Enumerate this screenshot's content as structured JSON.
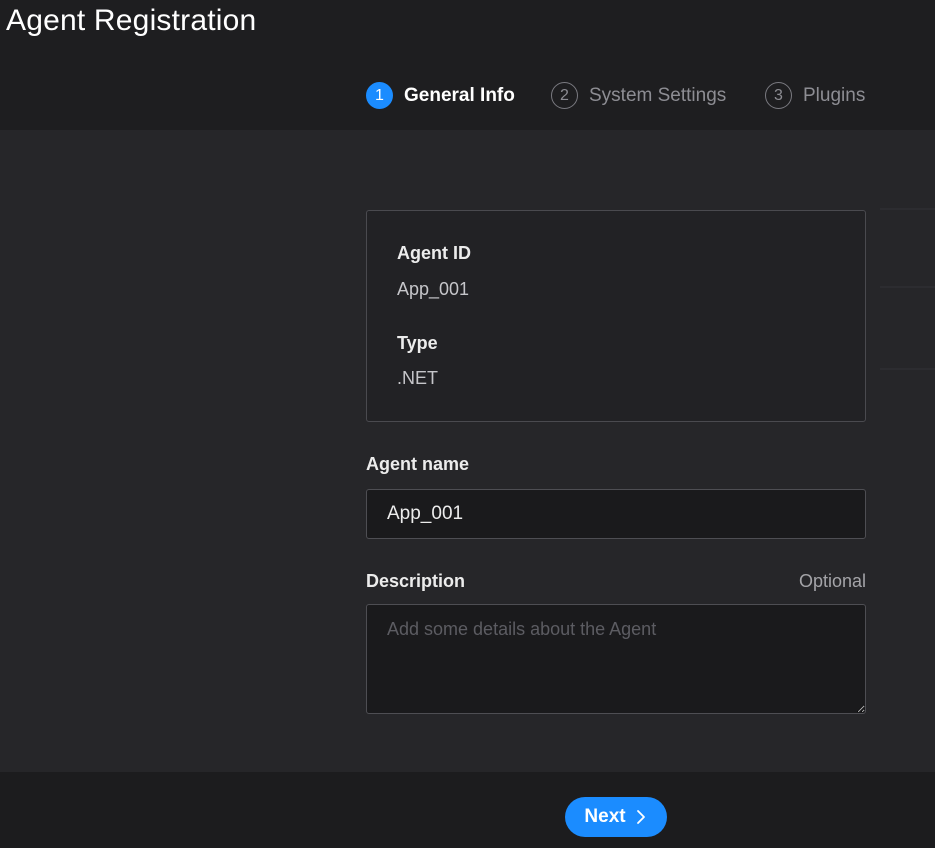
{
  "page": {
    "title": "Agent Registration"
  },
  "stepper": {
    "steps": [
      {
        "number": "1",
        "label": "General Info",
        "state": "active"
      },
      {
        "number": "2",
        "label": "System Settings",
        "state": "inactive"
      },
      {
        "number": "3",
        "label": "Plugins",
        "state": "inactive"
      }
    ]
  },
  "info_card": {
    "agent_id_label": "Agent ID",
    "agent_id_value": "App_001",
    "type_label": "Type",
    "type_value": ".NET"
  },
  "form": {
    "agent_name_label": "Agent name",
    "agent_name_value": "App_001",
    "description_label": "Description",
    "description_optional": "Optional",
    "description_value": "",
    "description_placeholder": "Add some details about the Agent"
  },
  "footer": {
    "next_label": "Next",
    "next_icon": "chevron-right-icon"
  },
  "colors": {
    "accent": "#1b8cff",
    "background": "#262629",
    "header_background": "#1e1e20"
  }
}
